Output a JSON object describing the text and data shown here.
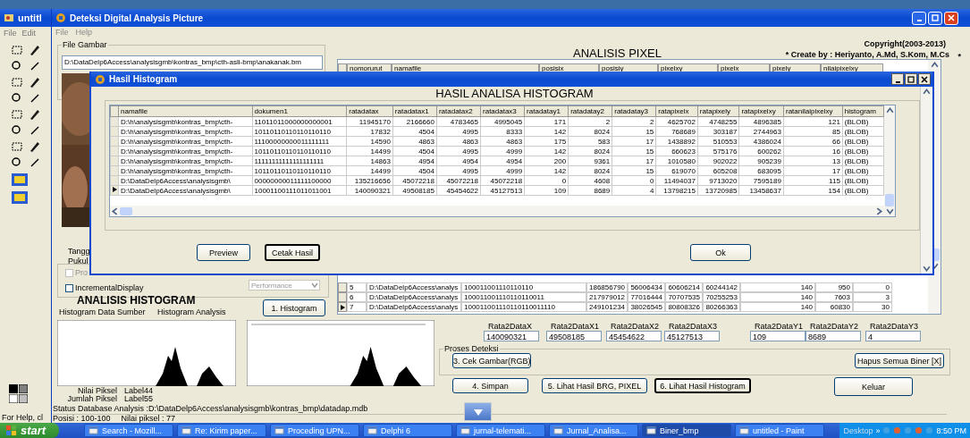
{
  "paint_window": {
    "title": "untitl",
    "menu": [
      "File",
      "Edit"
    ],
    "status": "For Help, cl"
  },
  "main_window": {
    "title": "Deteksi Digital Analysis Picture",
    "menu": [
      "File",
      "Help"
    ],
    "file_group": {
      "label": "File Gambar",
      "path": "D:\\DataDelp6Access\\analysisgmb\\kontras_bmp\\cth-asli-bmp\\anakanak.bm"
    },
    "heading": "ANALISIS PIXEL",
    "copyright": "Copyright(2003-2013)",
    "credit": "* Create by : Heriyanto, A.Md, S.Kom, M.Cs",
    "star": "*",
    "upper_grid": {
      "columns": [
        "nomorurut",
        "namafile",
        "posisix",
        "posisiy",
        "pixelxy",
        "pixelx",
        "pixely",
        "nilaipixelxy"
      ]
    },
    "lower_grid": {
      "rows": [
        {
          "selected": false,
          "cells": [
            "5",
            "D:\\DataDelp6Access\\analys",
            "100011001110110110",
            "186856790",
            "56006434",
            "60606214",
            "60244142",
            "140",
            "950",
            "0"
          ]
        },
        {
          "selected": false,
          "cells": [
            "6",
            "D:\\DataDelp6Access\\analys",
            "100011001110110110011",
            "217979012",
            "77016444",
            "70707535",
            "70255253",
            "140",
            "7603",
            "3"
          ]
        },
        {
          "selected": true,
          "cells": [
            "7",
            "D:\\DataDelp6Access\\analys",
            "100011001110110110011110",
            "249101234",
            "38026545",
            "80808326",
            "80266363",
            "140",
            "60830",
            "30"
          ]
        }
      ]
    },
    "date_labels": [
      "Tangg",
      "Pukul"
    ],
    "options": [
      {
        "label": "Pro",
        "checked": false,
        "disabled": true
      },
      {
        "label": "IncrementalDisplay",
        "checked": false,
        "disabled": false
      }
    ],
    "mode_dropdown": {
      "value": "Performance",
      "disabled": true
    },
    "histogram_section": {
      "title": "ANALISIS HISTOGRAM",
      "source_label": "Histogram Data Sumber",
      "analysis_label": "Histogram Analysis",
      "button": "1. Histogram"
    },
    "pixel_info": [
      {
        "label": "Nilai Piksel",
        "value": "Label44"
      },
      {
        "label": "Jumlah Piksel",
        "value": "Label55"
      }
    ],
    "averages": [
      {
        "label": "Rata2DataX",
        "value": "140090321"
      },
      {
        "label": "Rata2DataX1",
        "value": "49508185"
      },
      {
        "label": "Rata2DataX2",
        "value": "45454622"
      },
      {
        "label": "Rata2DataX3",
        "value": "45127513"
      },
      {
        "label": "Rata2DataY1",
        "value": "109"
      },
      {
        "label": "Rata2DataY2",
        "value": "8689"
      },
      {
        "label": "Rata2DataY3",
        "value": "4"
      }
    ],
    "detection_group": {
      "label": "Proses Deteksi",
      "buttons": [
        "3. Cek Gambar(RGB)",
        "Hapus Semua Biner [X]"
      ]
    },
    "actions": [
      {
        "label": "4. Simpan",
        "focused": false
      },
      {
        "label": "5. Lihat Hasil BRG, PIXEL",
        "focused": false
      },
      {
        "label": "6. Lihat Hasil Histogram",
        "focused": true
      },
      {
        "label": "Keluar",
        "focused": false
      }
    ],
    "status": "Status Database Analysis :D:\\DataDelp6Access\\analysisgmb\\kontras_bmp\\datadap.mdb",
    "position": "Posisi : 100-100",
    "pixel_value": "Nilai piksel : 77"
  },
  "dialog": {
    "title": "Hasil Histogram",
    "heading": "HASIL ANALISA HISTOGRAM",
    "table": {
      "columns": [
        "namafile",
        "dokumen1",
        "ratadatax",
        "ratadatax1",
        "ratadatax2",
        "ratadatax3",
        "ratadatay1",
        "ratadatay2",
        "ratadatay3",
        "ratapixelx",
        "ratapixely",
        "ratapixelxy",
        "ratanilaipixelxy",
        "histogram"
      ],
      "rows": [
        {
          "selected": false,
          "cells": [
            "D:\\h\\analysisgmb\\kontras_bmp\\cth-",
            "11011011000000000001",
            "11945170",
            "2166660",
            "4783465",
            "4995045",
            "171",
            "2",
            "2",
            "4625702",
            "4748255",
            "4896385",
            "121",
            "(BLOB)"
          ]
        },
        {
          "selected": false,
          "cells": [
            "D:\\h\\analysisgmb\\kontras_bmp\\cth-",
            "10110110110110110110",
            "17832",
            "4504",
            "4995",
            "8333",
            "142",
            "8024",
            "15",
            "768689",
            "303187",
            "2744963",
            "85",
            "(BLOB)"
          ]
        },
        {
          "selected": false,
          "cells": [
            "D:\\h\\analysisgmb\\kontras_bmp\\cth-",
            "11100000000011111111",
            "14590",
            "4863",
            "4863",
            "4863",
            "175",
            "583",
            "17",
            "1438892",
            "510553",
            "4386024",
            "66",
            "(BLOB)"
          ]
        },
        {
          "selected": false,
          "cells": [
            "D:\\h\\analysisgmb\\kontras_bmp\\cth-",
            "10110110110110110110",
            "14499",
            "4504",
            "4995",
            "4999",
            "142",
            "8024",
            "15",
            "660623",
            "575176",
            "600262",
            "16",
            "(BLOB)"
          ]
        },
        {
          "selected": false,
          "cells": [
            "D:\\h\\analysisgmb\\kontras_bmp\\cth-",
            "11111111111111111111",
            "14863",
            "4954",
            "4954",
            "4954",
            "200",
            "9361",
            "17",
            "1010580",
            "902022",
            "905239",
            "13",
            "(BLOB)"
          ]
        },
        {
          "selected": false,
          "cells": [
            "D:\\h\\analysisgmb\\kontras_bmp\\cth-",
            "10110110110110110110",
            "14499",
            "4504",
            "4995",
            "4999",
            "142",
            "8024",
            "15",
            "619070",
            "605208",
            "683095",
            "17",
            "(BLOB)"
          ]
        },
        {
          "selected": false,
          "cells": [
            "D:\\DataDelp6Access\\analysisgmb\\",
            "00000000011111100000",
            "135216656",
            "45072218",
            "45072218",
            "45072218",
            "0",
            "4608",
            "0",
            "11494037",
            "9713020",
            "7595189",
            "115",
            "(BLOB)"
          ]
        },
        {
          "selected": true,
          "cells": [
            "D:\\DataDelp6Access\\analysisgmb\\",
            "10001100111011011001",
            "140090321",
            "49508185",
            "45454622",
            "45127513",
            "109",
            "8689",
            "4",
            "13798215",
            "13720985",
            "13458637",
            "154",
            "(BLOB)"
          ]
        }
      ]
    },
    "buttons": [
      {
        "label": "Preview",
        "focused": false
      },
      {
        "label": "Cetak Hasil",
        "focused": true
      },
      {
        "label": "Ok",
        "focused": false
      }
    ]
  },
  "taskbar": {
    "start": "start",
    "items": [
      {
        "label": "Search - Mozill...",
        "selected": false
      },
      {
        "label": "Re: Kirim paper...",
        "selected": false
      },
      {
        "label": "Proceding UPN...",
        "selected": false
      },
      {
        "label": "Delphi 6",
        "selected": false
      },
      {
        "label": "jurnal-telemati...",
        "selected": false
      },
      {
        "label": "Jurnal_Analisa...",
        "selected": false
      },
      {
        "label": "Biner_bmp",
        "selected": true
      },
      {
        "label": "untitled - Paint",
        "selected": false
      }
    ],
    "desktop": "Desktop",
    "chevron": "»",
    "clock": "8:50 PM"
  }
}
